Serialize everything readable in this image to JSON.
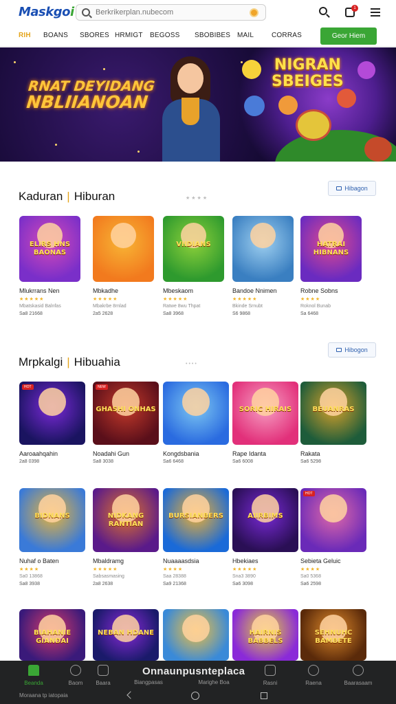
{
  "header": {
    "logo_main": "Maskgo",
    "logo_accent": "i",
    "search_placeholder": "Berkrikerplan.nubecom",
    "notification_count": "1"
  },
  "nav": {
    "items": [
      "RIH",
      "BOANS",
      "SBORES",
      "HRMIGT",
      "BEGOSS",
      "SBOBIBES",
      "MAIL",
      "CORRAS"
    ],
    "cta_label": "Geor Hiem"
  },
  "banner": {
    "left_line1": "RNAT DEYIDANG",
    "left_line2": "NBLIIANOAN",
    "right_line1": "NIGRAN",
    "right_line2": "SBEIGES"
  },
  "section1": {
    "title_a": "Kaduran",
    "title_b": "Hiburan",
    "button_label": "Hibagon",
    "cards": [
      {
        "name": "Mlukrrans Nen",
        "stars": "★★★★★",
        "meta": "Mbatskasid Balnfas",
        "meta2": "Sa8 21668",
        "art": "ELIRS HNS BAONAS"
      },
      {
        "name": "Mbkadhe",
        "stars": "★★★★★",
        "meta": "Mbakrbe 8rnlad",
        "meta2": "2a5 2628",
        "art": ""
      },
      {
        "name": "Mbeskaom",
        "stars": "★★★★★",
        "meta": "Ratwe 8wu Thpat",
        "meta2": "Sa8 3968",
        "art": "VIIDIANS"
      },
      {
        "name": "Bandoe Nnimen",
        "stars": "★★★★★",
        "meta": "Bkinde Srnubt",
        "meta2": "S6 9868",
        "art": ""
      },
      {
        "name": "Robne Sobns",
        "stars": "★★★★",
        "meta": "Roknol Bunab",
        "meta2": "Sa 6468",
        "art": "HATRAI HIBNANS"
      }
    ]
  },
  "section2": {
    "title_a": "Mrpkalgi",
    "title_b": "Hibuahia",
    "button_label": "Hibogon",
    "row1": [
      {
        "name": "Aaroaahqahin",
        "meta2": "2a8 0398",
        "art": "",
        "tag": "HOT"
      },
      {
        "name": "Noadahi Gun",
        "meta2": "Sa8 3038",
        "art": "GHASHI ONHAS",
        "tag": "NEW"
      },
      {
        "name": "Kongdsbania",
        "meta2": "Sa6 6468",
        "art": "",
        "tag": ""
      },
      {
        "name": "Rape Idanta",
        "meta2": "Sa6 6008",
        "art": "SORIC HIRAIS",
        "tag": ""
      },
      {
        "name": "Rakata",
        "meta2": "Sa6 5298",
        "art": "BEUANRAS",
        "tag": ""
      }
    ],
    "row2": [
      {
        "name": "Nuhaf o Baten",
        "stars": "★★★★",
        "meta": "Sa0 13868",
        "meta2": "Sa8 3938",
        "art": "BIDNANS",
        "tag": ""
      },
      {
        "name": "Mbaldramg",
        "stars": "★★★★★",
        "meta": "Sabsasmasing",
        "meta2": "2a8 2638",
        "art": "NIDKANG RANTIAN",
        "tag": ""
      },
      {
        "name": "Nuaaaasdsia",
        "stars": "★★★★",
        "meta": "Saa 28388",
        "meta2": "Sa9 21368",
        "art": "BURSIANBERS",
        "tag": ""
      },
      {
        "name": "Hbekiaes",
        "stars": "★★★★★",
        "meta": "Sna3 3890",
        "meta2": "Sa6 3098",
        "art": "AIIRBIMS",
        "tag": ""
      },
      {
        "name": "Sebieta Geluic",
        "stars": "★★★★",
        "meta": "Sa0 5368",
        "meta2": "Sa6 2598",
        "art": "",
        "tag": "HOT"
      }
    ],
    "row3": [
      {
        "art": "BIAHANIE GIANDAI"
      },
      {
        "art": "NEBAN HDANE"
      },
      {
        "art": ""
      },
      {
        "art": "HAIRNIS BABBELS"
      },
      {
        "art": "SEHNUHC BAMBETE"
      }
    ]
  },
  "bottom_nav": {
    "items": [
      "Beanda",
      "Baom",
      "Baara",
      "Biangpasas",
      "Marighe Boa",
      "Rasni",
      "Raena",
      "Baarasaam"
    ],
    "center_label": "Onnaunpusnteplaca",
    "system_text": "Moraana tp iatopaia"
  },
  "colors": {
    "accent_green": "#3aa635",
    "accent_gold": "#e4a51c",
    "link_blue": "#2d5fae"
  }
}
